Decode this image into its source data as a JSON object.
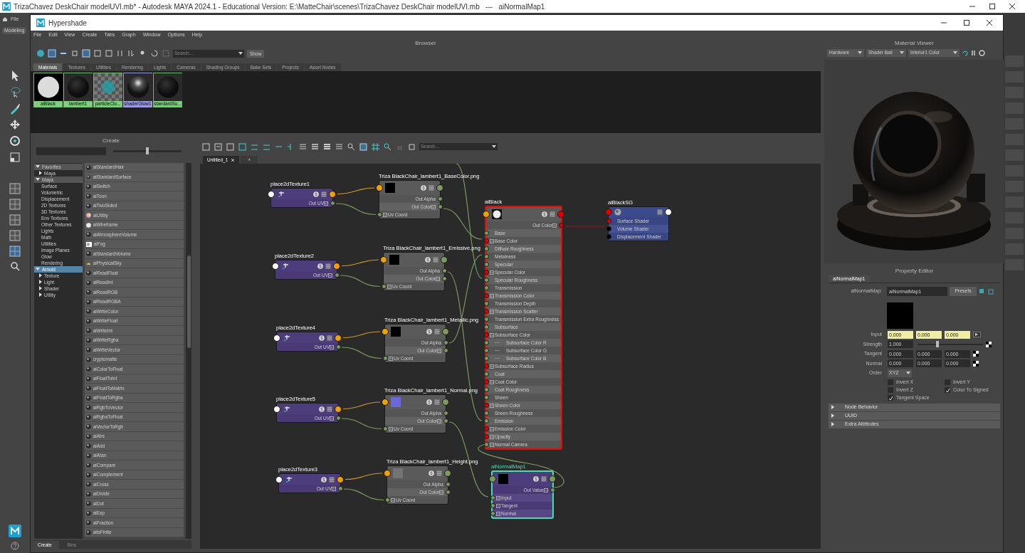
{
  "app_title_bar": {
    "title": "TrizaChavez DeskChair modelUVI.mb* - Autodesk MAYA 2024.1 - Educational Version: E:\\MatteChair\\scenes\\TrizaChavez DeskChair modelUVI.mb   ---   aiNormalMap1"
  },
  "app_menu": {
    "file": "File",
    "mode": "Modeling"
  },
  "hypershade": {
    "title": "Hypershade",
    "menu": [
      "File",
      "Edit",
      "View",
      "Create",
      "Tabs",
      "Graph",
      "Window",
      "Options",
      "Help"
    ]
  },
  "browser": {
    "title": "Browser",
    "search": {
      "placeholder": "Search..."
    },
    "show_button": "Show",
    "tabs": [
      {
        "label": "Materials",
        "selected": true
      },
      {
        "label": "Textures",
        "selected": false
      },
      {
        "label": "Utilities",
        "selected": false
      },
      {
        "label": "Rendering",
        "selected": false
      },
      {
        "label": "Lights",
        "selected": false
      },
      {
        "label": "Cameras",
        "selected": false
      },
      {
        "label": "Shading Groups",
        "selected": false
      },
      {
        "label": "Bake Sets",
        "selected": false
      },
      {
        "label": "Projects",
        "selected": false
      },
      {
        "label": "Asset Nodes",
        "selected": false
      }
    ],
    "swatches": [
      {
        "label": "aiBlack",
        "kind": "white_sphere",
        "selected": false
      },
      {
        "label": "lambert1",
        "kind": "dark_sphere",
        "selected": false
      },
      {
        "label": "particleClo...",
        "kind": "checker",
        "selected": false
      },
      {
        "label": "shaderGlow1",
        "kind": "glossy_sphere",
        "selected": true
      },
      {
        "label": "standardSu...",
        "kind": "dark_sphere",
        "selected": false
      }
    ]
  },
  "create_panel": {
    "title": "Create",
    "slider": {
      "level": 0.5
    },
    "tree": [
      {
        "label": "Favorites",
        "expanded": true,
        "selected": false,
        "children": [
          {
            "label": "Maya",
            "expanded": false,
            "selected": false
          }
        ]
      },
      {
        "label": "Maya",
        "expanded": true,
        "selected": false,
        "children": [
          {
            "label": "Surface"
          },
          {
            "label": "Volumetric"
          },
          {
            "label": "Displacement"
          },
          {
            "label": "2D Textures"
          },
          {
            "label": "3D Textures"
          },
          {
            "label": "Env Textures"
          },
          {
            "label": "Other Textures"
          },
          {
            "label": "Lights"
          },
          {
            "label": "Math"
          },
          {
            "label": "Utilities"
          },
          {
            "label": "Image Planes"
          },
          {
            "label": "Glow"
          },
          {
            "label": "Rendering"
          }
        ]
      },
      {
        "label": "Arnold",
        "expanded": true,
        "selected": true,
        "children": [
          {
            "label": "Texture",
            "expanded": false,
            "selected": false
          },
          {
            "label": "Light",
            "expanded": false,
            "selected": false
          },
          {
            "label": "Shader",
            "expanded": false,
            "selected": false
          },
          {
            "label": "Utility",
            "expanded": false,
            "selected": false
          }
        ]
      }
    ],
    "items": [
      {
        "label": "aiStandardHair",
        "kind": "sphere"
      },
      {
        "label": "aiStandardSurface",
        "kind": "small_sphere"
      },
      {
        "label": "aiSwitch",
        "kind": "sphere"
      },
      {
        "label": "aiToon",
        "kind": "sphere"
      },
      {
        "label": "aiTwoSided",
        "kind": "sphere"
      },
      {
        "label": "aiUtility",
        "kind": "rainbow"
      },
      {
        "label": "aiWireframe",
        "kind": "white"
      },
      {
        "label": "aiAtmosphereVolume",
        "kind": "sphere"
      },
      {
        "label": "aiFog",
        "kind": "fog"
      },
      {
        "label": "aiStandardVolume",
        "kind": "sphere"
      },
      {
        "label": "aiPhysicalSky",
        "kind": "sky"
      },
      {
        "label": "aiReadFloat",
        "kind": "sphere"
      },
      {
        "label": "aiReadInt",
        "kind": "sphere"
      },
      {
        "label": "aiReadRGB",
        "kind": "sphere"
      },
      {
        "label": "aiReadRGBA",
        "kind": "sphere"
      },
      {
        "label": "aiWriteColor",
        "kind": "sphere"
      },
      {
        "label": "aiWriteFloat",
        "kind": "sphere"
      },
      {
        "label": "aiWriteInt",
        "kind": "sphere"
      },
      {
        "label": "aiWriteRgba",
        "kind": "sphere"
      },
      {
        "label": "aiWriteVector",
        "kind": "sphere"
      },
      {
        "label": "cryptomatte",
        "kind": "sphere"
      },
      {
        "label": "aiColorToFloat",
        "kind": "sphere"
      },
      {
        "label": "aiFloatToInt",
        "kind": "sphere"
      },
      {
        "label": "aiFloatToMatrix",
        "kind": "sphere"
      },
      {
        "label": "aiFloatToRgba",
        "kind": "sphere"
      },
      {
        "label": "aiRgbToVector",
        "kind": "sphere"
      },
      {
        "label": "aiRgbaToFloat",
        "kind": "sphere"
      },
      {
        "label": "aiVectorToRgb",
        "kind": "sphere"
      },
      {
        "label": "aiAbs",
        "kind": "sphere"
      },
      {
        "label": "aiAdd",
        "kind": "sphere"
      },
      {
        "label": "aiAtan",
        "kind": "sphere"
      },
      {
        "label": "aiCompare",
        "kind": "sphere"
      },
      {
        "label": "aiComplement",
        "kind": "sphere"
      },
      {
        "label": "aiCross",
        "kind": "sphere"
      },
      {
        "label": "aiDivide",
        "kind": "sphere"
      },
      {
        "label": "aiDot",
        "kind": "sphere"
      },
      {
        "label": "aiExp",
        "kind": "sphere"
      },
      {
        "label": "aiFraction",
        "kind": "sphere"
      },
      {
        "label": "aiIsFinite",
        "kind": "sphere"
      }
    ],
    "bottom_tabs": [
      {
        "label": "Create",
        "selected": true
      },
      {
        "label": "Bins",
        "selected": false
      }
    ]
  },
  "node_editor": {
    "search": {
      "placeholder": "Search..."
    },
    "tabs": [
      {
        "label": "Untitled_1",
        "selected": true
      }
    ],
    "new_tab": "+",
    "nodes": [
      {
        "kind": "place2d",
        "title": "place2dTexture1",
        "selected": false,
        "ports": [
          {
            "label": "Out UV",
            "kind": "vector",
            "output": true
          }
        ]
      },
      {
        "kind": "file",
        "title": "Triza BlackChair_lambert1_BaseColor.png",
        "color": "#000000",
        "selected": false,
        "ports": [
          {
            "label": "Out Alpha",
            "kind": "float",
            "output": true
          },
          {
            "label": "Out Color",
            "kind": "vector",
            "output": true
          },
          {
            "label": "Uv Coord",
            "kind": "vector",
            "output": false
          }
        ]
      },
      {
        "kind": "place2d",
        "title": "place2dTexture2",
        "selected": false,
        "ports": [
          {
            "label": "Out UV",
            "kind": "vector",
            "output": true
          }
        ]
      },
      {
        "kind": "file",
        "title": "Triza BlackChair_lambert1_Emissive.png",
        "color": "#000000",
        "selected": false,
        "ports": [
          {
            "label": "Out Alpha",
            "kind": "float",
            "output": true
          },
          {
            "label": "Out Color",
            "kind": "vector",
            "output": true
          },
          {
            "label": "Uv Coord",
            "kind": "vector",
            "output": false
          }
        ]
      },
      {
        "kind": "place2d",
        "title": "place2dTexture4",
        "selected": false,
        "ports": [
          {
            "label": "Out UV",
            "kind": "vector",
            "output": true
          }
        ]
      },
      {
        "kind": "file",
        "title": "Triza BlackChair_lambert1_Metallic.png",
        "color": "#000000",
        "selected": false,
        "ports": [
          {
            "label": "Out Alpha",
            "kind": "float",
            "output": true
          },
          {
            "label": "Out Color",
            "kind": "vector",
            "output": true
          },
          {
            "label": "Uv Coord",
            "kind": "vector",
            "output": false
          }
        ]
      },
      {
        "kind": "place2d",
        "title": "place2dTexture5",
        "selected": false,
        "ports": [
          {
            "label": "Out UV",
            "kind": "vector",
            "output": true
          }
        ]
      },
      {
        "kind": "file",
        "title": "Triza BlackChair_lambert1_Normal.png",
        "color": "#6b68d8",
        "selected": false,
        "ports": [
          {
            "label": "Out Alpha",
            "kind": "float",
            "output": true
          },
          {
            "label": "Out Color",
            "kind": "vector",
            "output": true
          },
          {
            "label": "Uv Coord",
            "kind": "vector",
            "output": false
          }
        ]
      },
      {
        "kind": "place2d",
        "title": "place2dTexture3",
        "selected": false,
        "ports": [
          {
            "label": "Out UV",
            "kind": "vector",
            "output": true
          }
        ]
      },
      {
        "kind": "file",
        "title": "Triza BlackChair_lambert1_Height.png",
        "color": "#747474",
        "selected": false,
        "ports": [
          {
            "label": "Out Alpha",
            "kind": "float",
            "output": true
          },
          {
            "label": "Out Color",
            "kind": "vector",
            "output": true
          },
          {
            "label": "Uv Coord",
            "kind": "vector",
            "output": false
          }
        ]
      },
      {
        "kind": "shader",
        "title": "aiBlack",
        "selected": false,
        "color": "#ff0000",
        "ports": [
          {
            "label": "Out Color",
            "kind": "color",
            "output": true
          },
          {
            "label": "Base",
            "kind": "float",
            "output": false
          },
          {
            "label": "Base Color",
            "kind": "color",
            "output": false
          },
          {
            "label": "Diffuse Roughness",
            "kind": "float",
            "output": false
          },
          {
            "label": "Metalness",
            "kind": "float",
            "output": false
          },
          {
            "label": "Specular",
            "kind": "float",
            "output": false
          },
          {
            "label": "Specular Color",
            "kind": "color",
            "output": false
          },
          {
            "label": "Specular Roughness",
            "kind": "float",
            "output": false
          },
          {
            "label": "Transmission",
            "kind": "float",
            "output": false
          },
          {
            "label": "Transmission Color",
            "kind": "color",
            "output": false
          },
          {
            "label": "Transmission Depth",
            "kind": "float",
            "output": false
          },
          {
            "label": "Transmission Scatter",
            "kind": "color",
            "output": false
          },
          {
            "label": "Transmission Extra Roughness",
            "kind": "float",
            "output": false
          },
          {
            "label": "Subsurface",
            "kind": "float",
            "output": false
          },
          {
            "label": "Subsurface Color",
            "kind": "color",
            "output": false
          },
          {
            "label": "Subsurface Color R",
            "kind": "child",
            "output": false
          },
          {
            "label": "Subsurface Color G",
            "kind": "child",
            "output": false
          },
          {
            "label": "Subsurface Color B",
            "kind": "child",
            "output": false
          },
          {
            "label": "Subsurface Radius",
            "kind": "color",
            "output": false
          },
          {
            "label": "Coat",
            "kind": "float",
            "output": false
          },
          {
            "label": "Coat Color",
            "kind": "color",
            "output": false
          },
          {
            "label": "Coat Roughness",
            "kind": "float",
            "output": false
          },
          {
            "label": "Sheen",
            "kind": "float",
            "output": false
          },
          {
            "label": "Sheen Color",
            "kind": "color",
            "output": false
          },
          {
            "label": "Sheen Roughness",
            "kind": "float",
            "output": false
          },
          {
            "label": "Emission",
            "kind": "float",
            "output": false
          },
          {
            "label": "Emission Color",
            "kind": "color",
            "output": false
          },
          {
            "label": "Opacity",
            "kind": "color",
            "output": false
          },
          {
            "label": "Normal Camera",
            "kind": "vector",
            "output": false
          }
        ]
      },
      {
        "kind": "shading_group",
        "title": "aiBlackSG",
        "selected": false,
        "ports": [
          {
            "label": "Surface Shader",
            "kind": "shader",
            "output": false
          },
          {
            "label": "Volume Shader",
            "kind": "empty",
            "output": false
          },
          {
            "label": "Displacement Shader",
            "kind": "empty",
            "output": false
          }
        ]
      },
      {
        "kind": "normal_map",
        "title": "aiNormalMap1",
        "color": "#000000",
        "selected": true,
        "ports": [
          {
            "label": "Out Value",
            "kind": "vector",
            "output": true
          },
          {
            "label": "Input",
            "kind": "vector",
            "output": false
          },
          {
            "label": "Tangent",
            "kind": "vector",
            "output": false
          },
          {
            "label": "Normal",
            "kind": "vector",
            "output": false
          }
        ]
      }
    ]
  },
  "material_viewer": {
    "title": "Material Viewer",
    "renderer": "Hardware",
    "geometry": "Shader Ball",
    "environment": "Interior1 Color"
  },
  "property_editor": {
    "title": "Property Editor",
    "tab": "aiNormalMap1",
    "node_type_label": "aiNormalMap:",
    "node_name": "aiNormalMap1",
    "presets_button": "Presets",
    "vector_fields": [
      {
        "label": "Input",
        "values": [
          "0.000",
          "0.000",
          "0.000"
        ],
        "connected": true
      },
      {
        "label": "Tangent",
        "values": [
          "0.000",
          "0.000",
          "0.000"
        ],
        "connected": false
      },
      {
        "label": "Normal",
        "values": [
          "0.000",
          "0.000",
          "0.000"
        ],
        "connected": false
      }
    ],
    "strength": {
      "label": "Strength",
      "value": "1.000",
      "level": 0.3
    },
    "order": {
      "label": "Order",
      "value": "XYZ"
    },
    "checkboxes": [
      {
        "label": "Invert X",
        "checked": false
      },
      {
        "label": "Invert Y",
        "checked": false
      },
      {
        "label": "Invert Z",
        "checked": false
      },
      {
        "label": "Color To Signed",
        "checked": true
      },
      {
        "label": "Tangent Space",
        "checked": true
      }
    ],
    "sections": [
      {
        "label": "Node Behavior",
        "expanded": false
      },
      {
        "label": "UUID",
        "expanded": false
      },
      {
        "label": "Extra Attributes",
        "expanded": false
      }
    ]
  }
}
